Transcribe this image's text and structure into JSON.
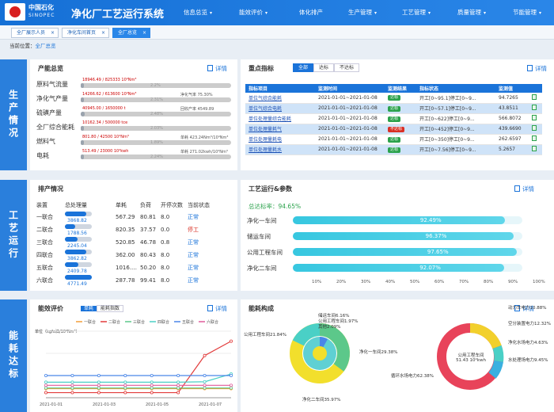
{
  "header": {
    "corp_cn": "中国石化",
    "corp_en": "SINOPEC",
    "title": "净化厂工艺运行系统",
    "nav": [
      "信息总览",
      "能效评价",
      "体化排产",
      "生产管理",
      "工艺管理",
      "质量管理",
      "节能管理"
    ]
  },
  "tabs": [
    {
      "label": "全厂展示人员",
      "x": "×"
    },
    {
      "label": "净化车间首页",
      "x": "×"
    },
    {
      "label": "全厂总览",
      "x": "×",
      "active": true
    }
  ],
  "breadcrumb": {
    "prefix": "当前位置：",
    "link": "全厂总览"
  },
  "sections": {
    "production": "生产情况",
    "process": "工艺运行",
    "energy": "能耗达标"
  },
  "more_label": "详情",
  "prod": {
    "title": "产能总览",
    "rows": [
      {
        "label": "原料气流量",
        "left": "18946.49 / 825333 10⁴Nm³",
        "right": "",
        "pct": "2.2%",
        "fill": 0.022
      },
      {
        "label": "净化气产量",
        "left": "14266.62 / 613600 10⁴Nm³",
        "right": "净化气率 75.30%",
        "pct": "2.31%",
        "fill": 0.023
      },
      {
        "label": "硫磺产量",
        "left": "40945.00 / 1650000 t",
        "right": "回收产率 4549.89",
        "pct": "2.48%",
        "fill": 0.025
      },
      {
        "label": "全厂综合能耗",
        "left": "10162.34 / 500000 tce",
        "right": "",
        "pct": "2.03%",
        "fill": 0.02
      },
      {
        "label": "燃料气",
        "left": "801.80 / 42500 10⁴Nm³",
        "right": "单耗 423.24Nm³/10⁴Nm³",
        "pct": "1.89%",
        "fill": 0.019
      },
      {
        "label": "电耗",
        "left": "513.49 / 23000 10⁴kwh",
        "right": "单耗 271.02kwh/10⁴Nm³",
        "pct": "2.24%",
        "fill": 0.022
      }
    ]
  },
  "key": {
    "title": "重点指标",
    "filters": [
      "全部",
      "达标",
      "不达标"
    ],
    "columns": [
      "指标项目",
      "监测时间",
      "监测结果",
      "指标状态",
      "监测值"
    ],
    "rows": [
      {
        "name": "单位气综合能耗",
        "time": "2021-01-01~2021-01-08",
        "result": "达标",
        "status": "开工[0~95.1]停工[0~9...",
        "value": "94.7265",
        "bad": false
      },
      {
        "name": "单位气综合电耗",
        "time": "2021-01-01~2021-01-08",
        "result": "达标",
        "status": "开工[0~57.1]停工[0~9...",
        "value": "43.8511",
        "bad": false
      },
      {
        "name": "单位处理量综合能耗",
        "time": "2021-01-01~2021-01-08",
        "result": "达标",
        "status": "开工[0~622]停工[0~9...",
        "value": "566.8072",
        "bad": false
      },
      {
        "name": "单位处理量耗气",
        "time": "2021-01-01~2021-01-08",
        "result": "不达标",
        "status": "开工[0~452]停工[0~9...",
        "value": "439.6690",
        "bad": true
      },
      {
        "name": "单位处理量耗电",
        "time": "2021-01-01~2021-01-08",
        "result": "达标",
        "status": "开工[0~350]停工[0~9...",
        "value": "262.6597",
        "bad": false
      },
      {
        "name": "单位处理量耗水",
        "time": "2021-01-01~2021-01-08",
        "result": "达标",
        "status": "开工[0~7.56]停工[0~9...",
        "value": "5.2657",
        "bad": false
      }
    ]
  },
  "paichan": {
    "title": "排产情况",
    "columns": [
      "装置",
      "总处理量",
      "单耗",
      "负荷",
      "开停次数",
      "当前状态"
    ],
    "rows": [
      {
        "name": "一联合",
        "total": "3868.82",
        "unit": "567.29",
        "load": "80.81",
        "times": "8.0",
        "state": "正常",
        "fill": 0.8,
        "bad": false
      },
      {
        "name": "二联合",
        "total": "1788.56",
        "unit": "820.35",
        "load": "37.57",
        "times": "0.0",
        "state": "停工",
        "fill": 0.38,
        "bad": true
      },
      {
        "name": "三联合",
        "total": "2245.04",
        "unit": "520.85",
        "load": "46.78",
        "times": "0.8",
        "state": "正常",
        "fill": 0.47,
        "bad": false
      },
      {
        "name": "四联合",
        "total": "3862.82",
        "unit": "362.00",
        "load": "80.43",
        "times": "8.0",
        "state": "正常",
        "fill": 0.8,
        "bad": false
      },
      {
        "name": "五联合",
        "total": "2409.78",
        "unit": "1016.…",
        "load": "50.20",
        "times": "8.0",
        "state": "正常",
        "fill": 0.5,
        "bad": false
      },
      {
        "name": "六联合",
        "total": "4771.49",
        "unit": "287.78",
        "load": "99.41",
        "times": "8.0",
        "state": "正常",
        "fill": 0.99,
        "bad": false
      }
    ]
  },
  "process": {
    "title": "工艺运行&参数",
    "rate_label": "总达标率：",
    "rate": "94.65%",
    "bars": [
      {
        "label": "净化一车间",
        "value": "92.49%",
        "fill": 0.9249
      },
      {
        "label": "储运车间",
        "value": "96.37%",
        "fill": 0.9637
      },
      {
        "label": "公用工程车间",
        "value": "97.65%",
        "fill": 0.9765
      },
      {
        "label": "净化二车间",
        "value": "92.07%",
        "fill": 0.9207
      }
    ],
    "ticks": [
      "10%",
      "20%",
      "30%",
      "40%",
      "50%",
      "60%",
      "70%",
      "80%",
      "90%",
      "100%"
    ]
  },
  "energy_eval": {
    "title": "能效评价",
    "toggle": [
      "单耗",
      "能耗指数"
    ],
    "ylabel": "单位（kgfo油/10⁴Nm³）",
    "legend": [
      {
        "name": "一联合",
        "color": "#f29d38"
      },
      {
        "name": "二联合",
        "color": "#e23b3b"
      },
      {
        "name": "三联合",
        "color": "#5cc88a"
      },
      {
        "name": "四联合",
        "color": "#4ad0c6"
      },
      {
        "name": "五联合",
        "color": "#4a86e8"
      },
      {
        "name": "六联合",
        "color": "#e05a9a"
      }
    ],
    "xticks": [
      "2021-01-01",
      "2021-01-03",
      "2021-01-05",
      "2021-01-07"
    ]
  },
  "energy_struct": {
    "title": "能耗构成",
    "donut1": {
      "center": "",
      "labels": [
        "储运车间6.16%",
        "公用工程车间1.97%",
        "其他2.09%",
        "净化一车间29.38%",
        "公用工程车间21.84%",
        "净化二车间35.97%"
      ]
    },
    "donut2": {
      "center1": "公用工程车间",
      "center2": "51.43 10⁴kwh",
      "labels": [
        "动力车电力10.88%",
        "空分装置电力12.32%",
        "净化水场电力4.63%",
        "水处理场电力9.45%",
        "循环水场电力62.38%"
      ]
    }
  },
  "chart_data": {
    "type": "line",
    "title": "能效评价",
    "ylabel": "单位（kgfo油/10⁴Nm³）",
    "x": [
      "2021-01-01",
      "2021-01-02",
      "2021-01-03",
      "2021-01-04",
      "2021-01-05",
      "2021-01-06",
      "2021-01-07",
      "2021-01-08"
    ],
    "series": [
      {
        "name": "一联合",
        "values": [
          410,
          410,
          410,
          410,
          410,
          410,
          410,
          412
        ]
      },
      {
        "name": "二联合",
        "values": [
          230,
          230,
          230,
          230,
          230,
          230,
          1900,
          2550
        ]
      },
      {
        "name": "三联合",
        "values": [
          440,
          440,
          440,
          440,
          440,
          440,
          440,
          440
        ]
      },
      {
        "name": "四联合",
        "values": [
          700,
          700,
          700,
          700,
          700,
          700,
          720,
          1070
        ]
      },
      {
        "name": "五联合",
        "values": [
          1000,
          1000,
          1000,
          1000,
          1000,
          1000,
          1000,
          1000
        ]
      },
      {
        "name": "六联合",
        "values": [
          560,
          560,
          560,
          560,
          560,
          560,
          560,
          560
        ]
      }
    ],
    "ylim": [
      0,
      3000
    ],
    "legend": "top"
  }
}
